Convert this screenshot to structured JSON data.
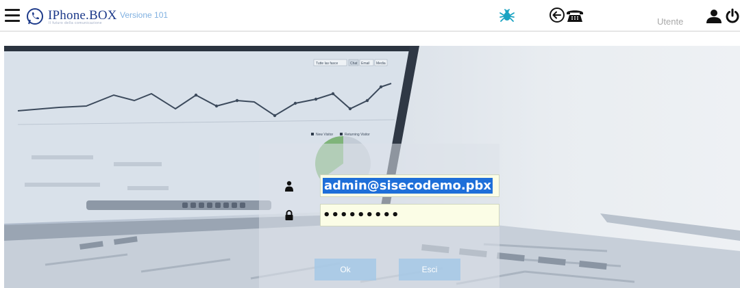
{
  "header": {
    "brand": "IPhone.BOX",
    "tagline": "Il futuro della comunicazione",
    "version": "Versione 101",
    "user_label": "Utente"
  },
  "icons": {
    "menu": "hamburger-icon",
    "logo": "phone-logo-icon",
    "debug": "bug-icon",
    "callback": "phone-back-icon",
    "user": "user-icon",
    "logout": "power-icon"
  },
  "login": {
    "username": "admin@sisecodemo.pbx",
    "password": "•••••••••",
    "ok_label": "Ok",
    "cancel_label": "Esci"
  },
  "hero_chart": {
    "top_tabs": [
      "Tutte las fasce",
      "Chat",
      "Email",
      "Media"
    ],
    "legend": [
      "New Visitor",
      "Returning Visitor"
    ]
  },
  "colors": {
    "brand": "#1d3a8a",
    "version": "#7fb0e0",
    "bug": "#1aa3c2",
    "input_bg": "#fbfde6",
    "button_bg": "#a5c8e6",
    "selection": "#1e6fd9"
  }
}
